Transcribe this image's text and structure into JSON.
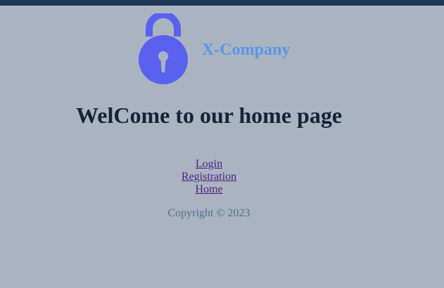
{
  "header": {
    "company_name": "X-Company",
    "logo_icon": "lock-icon",
    "colors": {
      "top_bar": "#1d3556",
      "logo": "#5b61ef",
      "company": "#5c95e7"
    }
  },
  "main": {
    "heading": "WelCome to our home page"
  },
  "nav": {
    "items": [
      {
        "label": "Login"
      },
      {
        "label": "Registration"
      },
      {
        "label": "Home"
      }
    ]
  },
  "footer": {
    "copyright": "Copyright © 2023"
  }
}
